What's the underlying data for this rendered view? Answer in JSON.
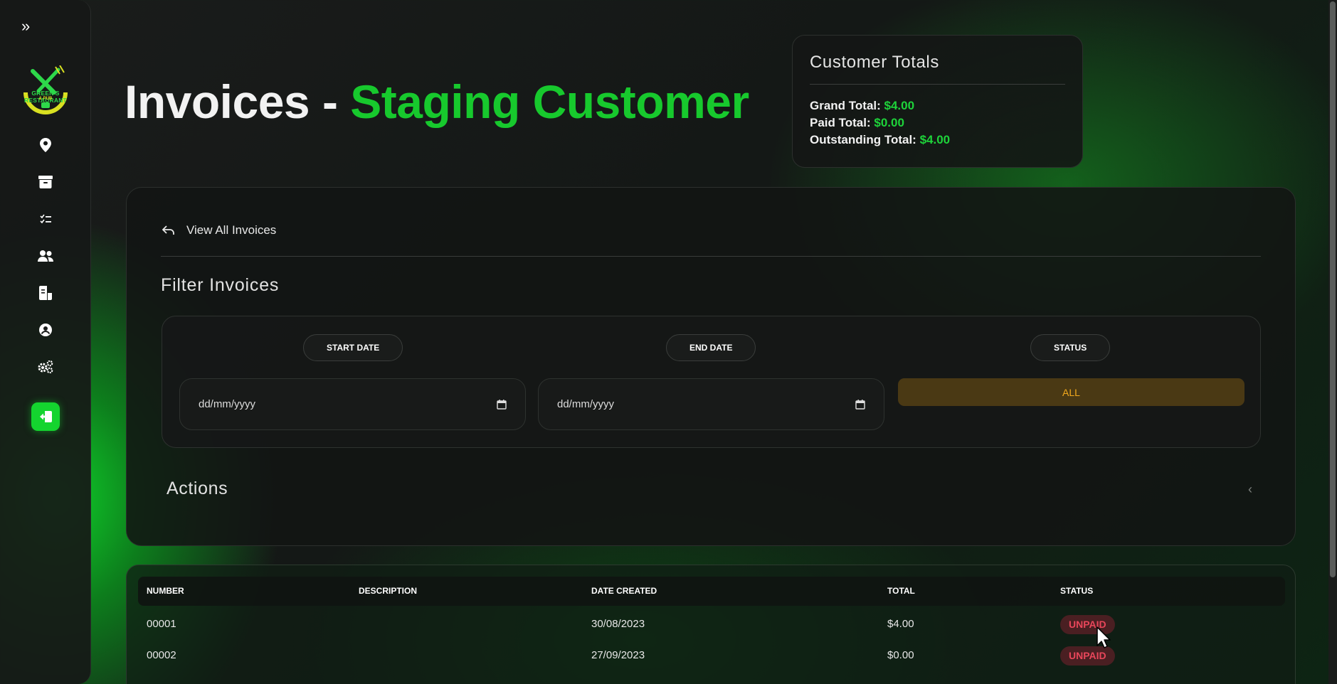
{
  "sidebar": {
    "expand_icon": "double-chevron-right-icon",
    "logo": {
      "text": "GREEN'S RESTAURANT",
      "subtext": "& PUB"
    },
    "nav_items": [
      {
        "name": "location",
        "icon": "map-pin-icon"
      },
      {
        "name": "inventory",
        "icon": "archive-box-icon"
      },
      {
        "name": "tasks",
        "icon": "checklist-icon"
      },
      {
        "name": "customers",
        "icon": "users-icon"
      },
      {
        "name": "invoices",
        "icon": "document-icon"
      },
      {
        "name": "account",
        "icon": "user-circle-icon"
      },
      {
        "name": "settings",
        "icon": "gears-icon"
      }
    ],
    "logout_icon": "sign-out-icon"
  },
  "header": {
    "title_prefix": "Invoices - ",
    "title_customer": "Staging Customer"
  },
  "totals": {
    "heading": "Customer Totals",
    "grand_label": "Grand Total: ",
    "grand_value": "$4.00",
    "paid_label": "Paid Total: ",
    "paid_value": "$0.00",
    "outstanding_label": "Outstanding Total: ",
    "outstanding_value": "$4.00"
  },
  "panel": {
    "view_all_label": "View All Invoices",
    "filter_title": "Filter Invoices",
    "filters": {
      "start_label": "START DATE",
      "end_label": "END DATE",
      "status_label": "STATUS",
      "start_placeholder": "dd/mm/yyyy",
      "end_placeholder": "dd/mm/yyyy",
      "status_value": "ALL"
    },
    "actions_title": "Actions",
    "actions_chevron": "‹"
  },
  "table": {
    "headers": [
      "NUMBER",
      "DESCRIPTION",
      "DATE CREATED",
      "TOTAL",
      "STATUS"
    ],
    "rows": [
      {
        "number": "00001",
        "description": "",
        "date": "30/08/2023",
        "total": "$4.00",
        "status": "UNPAID"
      },
      {
        "number": "00002",
        "description": "",
        "date": "27/09/2023",
        "total": "$0.00",
        "status": "UNPAID"
      }
    ]
  },
  "colors": {
    "accent_green": "#17c92d",
    "unpaid_red": "#e8465a",
    "status_amber": "#f2a91d"
  }
}
